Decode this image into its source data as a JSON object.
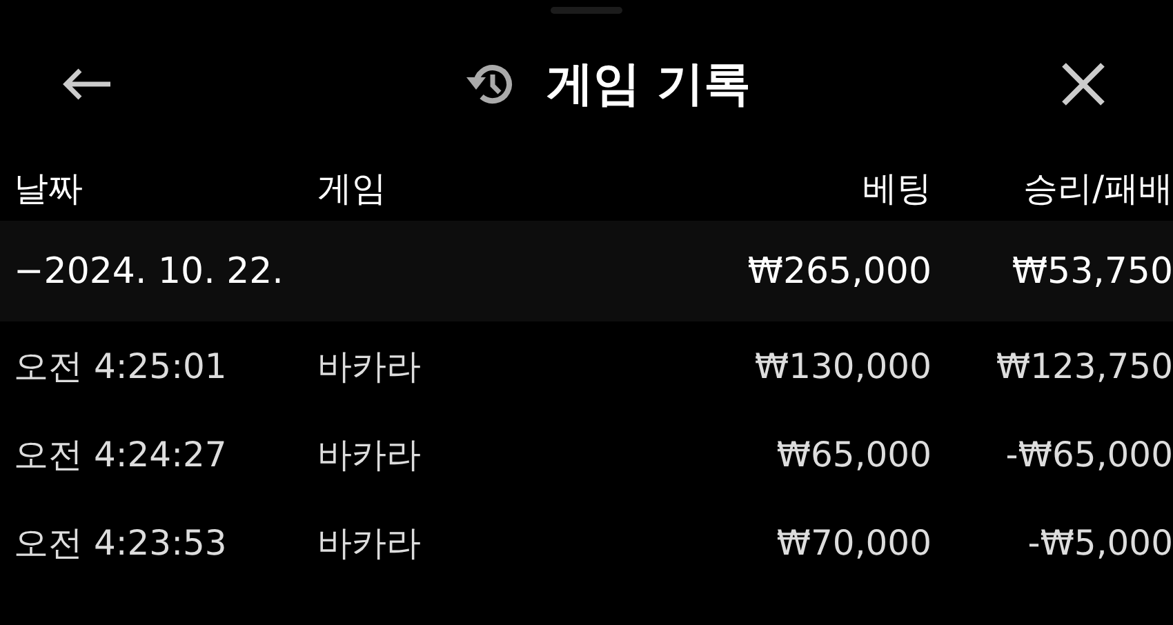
{
  "header": {
    "title": "게임 기록"
  },
  "table": {
    "columns": [
      "날짜",
      "게임",
      "베팅",
      "승리/패배"
    ],
    "groups": [
      {
        "date": "−2024. 10. 22.",
        "bet": "₩265,000",
        "result": "₩53,750",
        "rows": [
          {
            "time": "오전 4:25:01",
            "game": "바카라",
            "bet": "₩130,000",
            "result": "₩123,750"
          },
          {
            "time": "오전 4:24:27",
            "game": "바카라",
            "bet": "₩65,000",
            "result": "-₩65,000"
          },
          {
            "time": "오전 4:23:53",
            "game": "바카라",
            "bet": "₩70,000",
            "result": "-₩5,000"
          }
        ]
      }
    ]
  }
}
